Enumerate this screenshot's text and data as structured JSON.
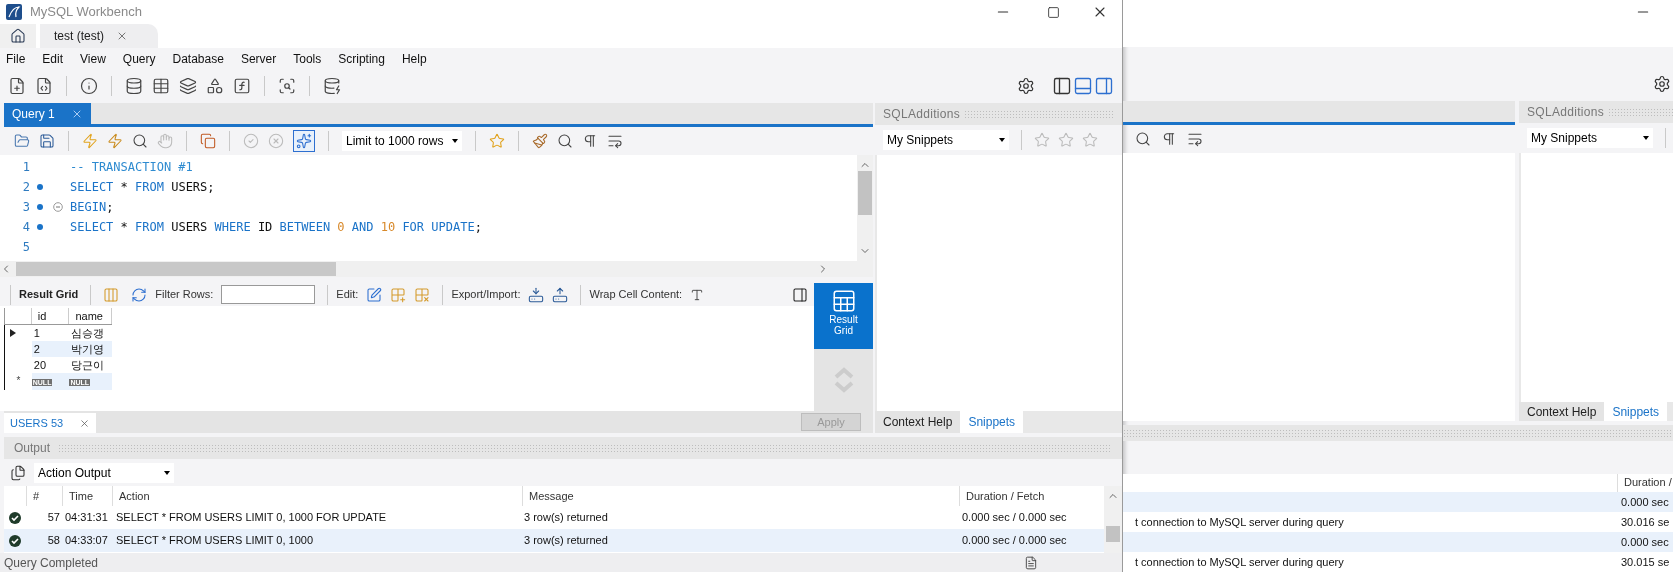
{
  "front": {
    "title": "MySQL Workbench",
    "connection_tabs": [
      {
        "label": "test (test)",
        "selected": true
      }
    ],
    "menu": [
      "File",
      "Edit",
      "View",
      "Query",
      "Database",
      "Server",
      "Tools",
      "Scripting",
      "Help"
    ],
    "query_tabs": [
      {
        "label": "Query 1",
        "selected": true
      }
    ],
    "limit_dropdown": "Limit to 1000 rows",
    "editor_lines": [
      {
        "number": "1",
        "marker": false,
        "fold": false,
        "tokens": [
          {
            "kind": "comment",
            "text": "-- TRANSACTION #1"
          }
        ]
      },
      {
        "number": "2",
        "marker": true,
        "fold": false,
        "tokens": [
          {
            "kind": "keyword",
            "text": "SELECT"
          },
          {
            "kind": "plain",
            "text": " * "
          },
          {
            "kind": "keyword",
            "text": "FROM"
          },
          {
            "kind": "plain",
            "text": " USERS;"
          }
        ]
      },
      {
        "number": "3",
        "marker": true,
        "fold": true,
        "tokens": [
          {
            "kind": "keyword",
            "text": "BEGIN"
          },
          {
            "kind": "plain",
            "text": ";"
          }
        ]
      },
      {
        "number": "4",
        "marker": true,
        "fold": false,
        "tokens": [
          {
            "kind": "keyword",
            "text": "SELECT"
          },
          {
            "kind": "plain",
            "text": " * "
          },
          {
            "kind": "keyword",
            "text": "FROM"
          },
          {
            "kind": "plain",
            "text": " USERS "
          },
          {
            "kind": "keyword",
            "text": "WHERE"
          },
          {
            "kind": "plain",
            "text": " ID "
          },
          {
            "kind": "keyword",
            "text": "BETWEEN "
          },
          {
            "kind": "number",
            "text": "0"
          },
          {
            "kind": "keyword",
            "text": " AND "
          },
          {
            "kind": "number",
            "text": "10"
          },
          {
            "kind": "keyword",
            "text": " FOR UPDATE"
          },
          {
            "kind": "plain",
            "text": ";"
          }
        ]
      },
      {
        "number": "5",
        "marker": false,
        "fold": false
      }
    ],
    "result_toolbar": {
      "result_grid": "Result Grid",
      "filter_label": "Filter Rows:",
      "edit_label": "Edit:",
      "export_label": "Export/Import:",
      "wrap_label": "Wrap Cell Content:"
    },
    "grid": {
      "columns": [
        "id",
        "name"
      ],
      "rows": [
        {
          "cells": [
            "1",
            "심승갱"
          ],
          "current": true
        },
        {
          "cells": [
            "2",
            "박기영"
          ],
          "current": false
        },
        {
          "cells": [
            "20",
            "당근이"
          ],
          "current": false
        }
      ],
      "new_row": {
        "marker": "*",
        "cells": [
          "NULL",
          "NULL"
        ]
      }
    },
    "side_button": {
      "label": "Result Grid",
      "selected": true
    },
    "result_tabs": [
      {
        "label": "USERS 53",
        "selected": true
      }
    ],
    "apply": {
      "label": "Apply",
      "disabled": true
    },
    "sidebar": {
      "title": "SQLAdditions",
      "dropdown": "My Snippets",
      "tabs": [
        {
          "label": "Context Help",
          "selected": false
        },
        {
          "label": "Snippets",
          "selected": true
        }
      ]
    },
    "output": {
      "title": "Output",
      "dropdown": "Action Output",
      "columns": [
        "#",
        "Time",
        "Action",
        "Message",
        "Duration / Fetch"
      ],
      "rows": [
        {
          "kind": "success",
          "cells": [
            "57",
            "04:31:31",
            "SELECT * FROM USERS  LIMIT 0, 1000 FOR UPDATE",
            "3 row(s) returned",
            "0.000 sec / 0.000 sec"
          ]
        },
        {
          "kind": "success",
          "cells": [
            "58",
            "04:33:07",
            "SELECT * FROM USERS LIMIT 0, 1000",
            "3 row(s) returned",
            "0.000 sec / 0.000 sec"
          ]
        }
      ]
    },
    "status": "Query Completed"
  },
  "back": {
    "sidebar": {
      "title": "SQLAdditions",
      "dropdown": "My Snippets",
      "tabs": [
        {
          "label": "Context Help",
          "selected": false
        },
        {
          "label": "Snippets",
          "selected": true
        }
      ]
    },
    "output": {
      "columns": [
        "Duration /"
      ],
      "rows": [
        {
          "duration": "0.000 sec"
        },
        {
          "message": "t connection to MySQL server during query",
          "duration": "30.016 se"
        },
        {
          "duration": "0.000 sec"
        },
        {
          "message": "t connection to MySQL server during query",
          "duration": "30.015 se"
        }
      ]
    }
  }
}
